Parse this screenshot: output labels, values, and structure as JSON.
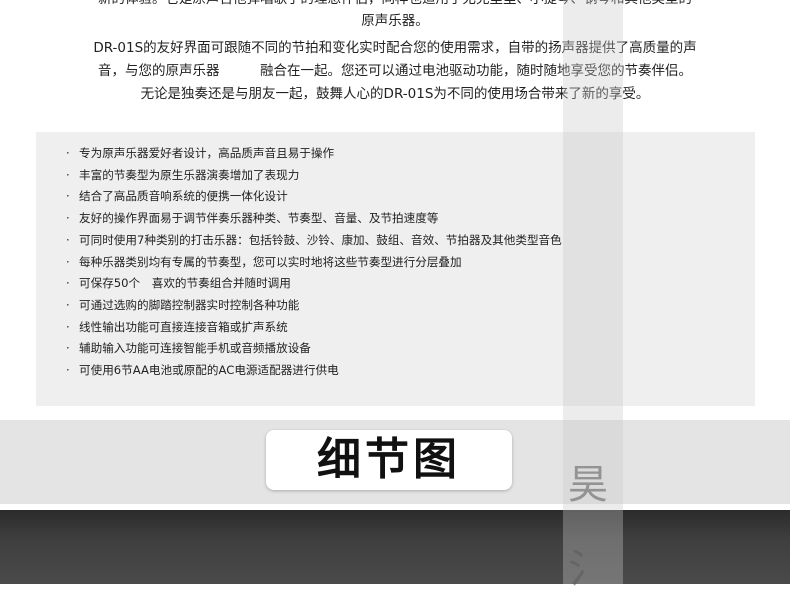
{
  "intro": {
    "line0": "新的体验。它是原声吉他弹唱歌手的理想伴侣，同样也适用于尤克里里、小提琴、钢琴和其他类型的",
    "line1": "原声乐器。",
    "line2": "DR-01S的友好界面可跟随不同的节拍和变化实时配合您的使用需求，自带的扬声器提供了高质量的声",
    "line3": "音，与您的原声乐器　　　融合在一起。您还可以通过电池驱动功能，随时随地享受您的节奏伴侣。",
    "line4": "无论是独奏还是与朋友一起，鼓舞人心的DR-01S为不同的使用场合带来了新的享受。"
  },
  "features": [
    "专为原声乐器爱好者设计，高品质声音且易于操作",
    "丰富的节奏型为原生乐器演奏增加了表现力",
    "结合了高品质音响系统的便携一体化设计",
    "友好的操作界面易于调节伴奏乐器种类、节奏型、音量、及节拍速度等",
    "可同时使用7种类别的打击乐器：包括铃鼓、沙铃、康加、鼓组、音效、节拍器及其他类型音色",
    "每种乐器类别均有专属的节奏型，您可以实时地将这些节奏型进行分层叠加",
    "可保存50个　喜欢的节奏组合并随时调用",
    "可通过选购的脚踏控制器实时控制各种功能",
    "线性输出功能可直接连接音箱或扩声系统",
    "辅助输入功能可连接智能手机或音频播放设备",
    "可使用6节AA电池或原配的AC电源适配器进行供电"
  ],
  "bullet": "·",
  "detail_title": "细节图",
  "watermark": [
    "昊",
    "氵"
  ]
}
